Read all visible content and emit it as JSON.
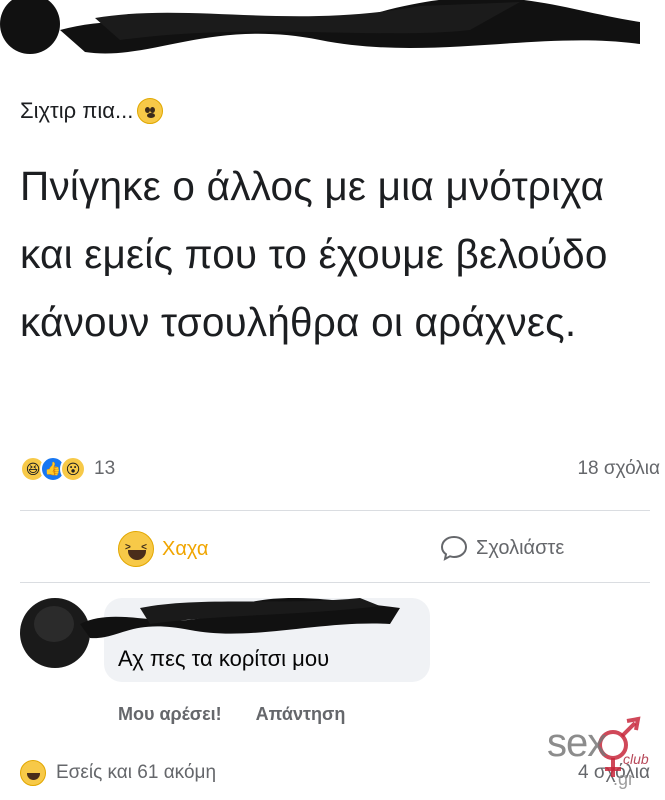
{
  "post": {
    "subtitle": "Σιχτιρ πια...",
    "text": "Πνίγηκε ο άλλος με μια μνότριχα και εμείς που το έχουμε βελούδο κάνουν τσουλήθρα οι αράχνες.",
    "reaction_count": "13",
    "comments_count": "18 σχόλια",
    "reaction_icons": [
      "haha-icon",
      "like-icon",
      "wow-icon"
    ]
  },
  "actions": {
    "haha_label": "Χαχα",
    "comment_label": "Σχολιάστε"
  },
  "comment": {
    "text": "Αχ πες τα κορίτσι μου",
    "like_label": "Μου αρέσει!",
    "reply_label": "Απάντηση"
  },
  "footer": {
    "reactions_text": "Εσείς και 61 ακόμη",
    "comments_text": "4 σχόλια"
  },
  "watermark": {
    "brand": "sex",
    "club": "club",
    "tld": ".gr"
  },
  "colors": {
    "haha_accent": "#f0a500",
    "like_blue": "#1877f2",
    "muted_text": "#65676b",
    "bubble_bg": "#f0f2f5"
  }
}
